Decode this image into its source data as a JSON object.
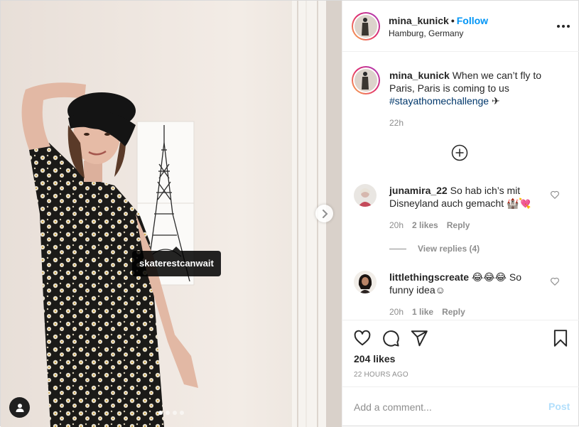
{
  "post": {
    "author": {
      "username": "mina_kunick",
      "separator": "•",
      "follow_label": "Follow",
      "location": "Hamburg, Germany"
    },
    "more_icon": "more-horizontal-icon",
    "media": {
      "tag_label": "skaterestcanwait",
      "carousel": {
        "total": 4,
        "current": 1
      },
      "next_icon": "chevron-right-icon",
      "user_tags_icon": "person-icon"
    },
    "caption": {
      "username": "mina_kunick",
      "text": "When we can’t fly to Paris, Paris is coming to us",
      "hashtag": "#stayathomechallenge",
      "emoji": "✈",
      "time": "22h"
    },
    "load_more_icon": "plus-circle-icon",
    "comments": [
      {
        "username": "junamira_22",
        "text": "So hab ich’s mit Disneyland auch gemacht 🏰💘",
        "time": "20h",
        "likes": "2 likes",
        "reply_label": "Reply",
        "view_replies": "View replies (4)"
      },
      {
        "username": "littlethingscreate",
        "text": "😂😂😂 So funny idea☺",
        "time": "20h",
        "likes": "1 like",
        "reply_label": "Reply"
      }
    ],
    "actions": {
      "icons": [
        "heart-icon",
        "comment-icon",
        "share-icon",
        "bookmark-icon"
      ],
      "likes": "204 likes",
      "time_ago": "22 HOURS AGO"
    },
    "add_comment": {
      "placeholder": "Add a comment...",
      "post_label": "Post"
    },
    "colors": {
      "accent": "#0095f6",
      "post_disabled": "#b2dffc",
      "hashtag": "#00376b",
      "muted": "#8e8e8e"
    }
  }
}
